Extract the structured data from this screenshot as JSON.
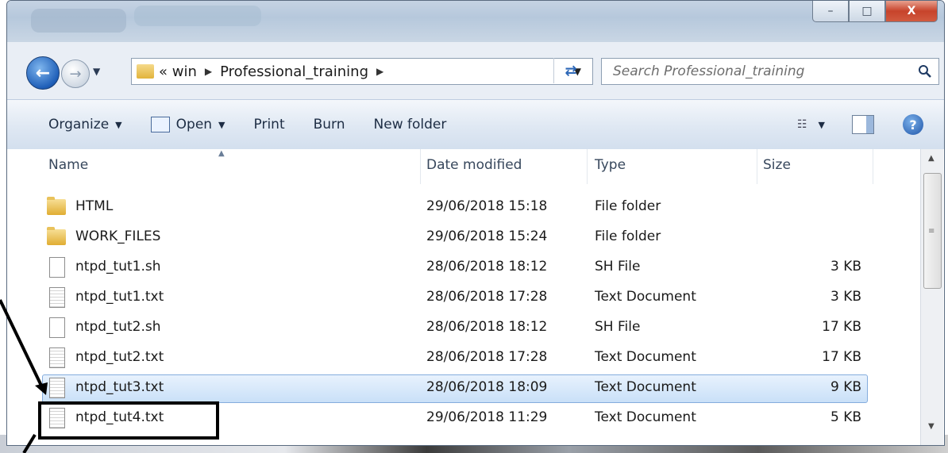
{
  "window": {
    "title_buttons": {
      "minimize": "–",
      "maximize": "□",
      "close": "X"
    }
  },
  "navbar": {
    "breadcrumb": [
      "« win",
      "Professional_training"
    ],
    "search_placeholder": "Search Professional_training"
  },
  "toolbar": {
    "items": [
      "Organize",
      "Open",
      "Print",
      "Burn",
      "New folder"
    ]
  },
  "columns": {
    "name": "Name",
    "date": "Date modified",
    "type": "Type",
    "size": "Size"
  },
  "files": [
    {
      "name": "HTML",
      "date": "29/06/2018 15:18",
      "type": "File folder",
      "size": "",
      "icon": "folder-icon"
    },
    {
      "name": "WORK_FILES",
      "date": "29/06/2018 15:24",
      "type": "File folder",
      "size": "",
      "icon": "folder-icon"
    },
    {
      "name": "ntpd_tut1.sh",
      "date": "28/06/2018 18:12",
      "type": "SH File",
      "size": "3 KB",
      "icon": "file-icon"
    },
    {
      "name": "ntpd_tut1.txt",
      "date": "28/06/2018 17:28",
      "type": "Text Document",
      "size": "3 KB",
      "icon": "text-file-icon"
    },
    {
      "name": "ntpd_tut2.sh",
      "date": "28/06/2018 18:12",
      "type": "SH File",
      "size": "17 KB",
      "icon": "file-icon"
    },
    {
      "name": "ntpd_tut2.txt",
      "date": "28/06/2018 17:28",
      "type": "Text Document",
      "size": "17 KB",
      "icon": "text-file-icon"
    },
    {
      "name": "ntpd_tut3.txt",
      "date": "28/06/2018 18:09",
      "type": "Text Document",
      "size": "9 KB",
      "icon": "text-file-icon",
      "selected": true
    },
    {
      "name": "ntpd_tut4.txt",
      "date": "29/06/2018 11:29",
      "type": "Text Document",
      "size": "5 KB",
      "icon": "text-file-icon"
    }
  ]
}
